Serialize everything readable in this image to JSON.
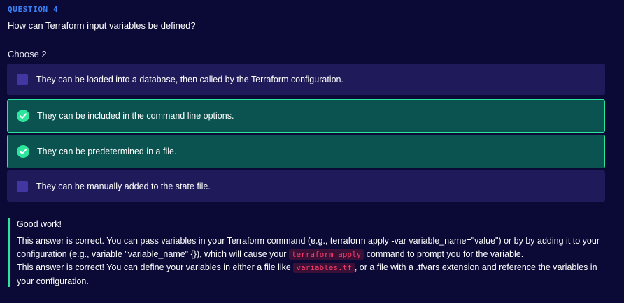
{
  "question": {
    "number_label": "QUESTION 4",
    "text": "How can Terraform input variables be defined?",
    "choose_label": "Choose 2"
  },
  "options": [
    {
      "label": "They can be loaded into a database, then called by the Terraform configuration.",
      "selected": false,
      "correct": false
    },
    {
      "label": "They can be included in the command line options.",
      "selected": true,
      "correct": true
    },
    {
      "label": "They can be predetermined in a file.",
      "selected": true,
      "correct": true
    },
    {
      "label": "They can be manually added to the state file.",
      "selected": false,
      "correct": false
    }
  ],
  "feedback": {
    "title": "Good work!",
    "para1_before": "This answer is correct. You can pass variables in your Terraform command (e.g., terraform apply -var variable_name=\"value\") or by by adding it to your configuration (e.g., variable \"variable_name\" {}), which will cause your ",
    "para1_code": "terraform apply",
    "para1_after": " command to prompt you for the variable.",
    "para2_before": "This answer is correct! You can define your variables in either a file like ",
    "para2_code": "variables.tf",
    "para2_after": ", or a file with a .tfvars extension and reference the variables in your configuration."
  },
  "colors": {
    "background": "#0b0a37",
    "accent_blue": "#3b82f6",
    "correct_green": "#2ee59d",
    "correct_bg": "#0b5350",
    "option_bg": "#1f1b5a",
    "checkbox": "#4236a3",
    "code_text": "#ff3b6b"
  },
  "icons": {
    "correct": "check-circle-icon",
    "unselected": "checkbox-icon"
  }
}
